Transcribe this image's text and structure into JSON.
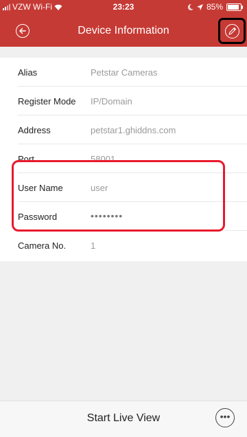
{
  "status_bar": {
    "carrier": "VZW Wi-Fi",
    "time": "23:23",
    "battery": "85%"
  },
  "header": {
    "title": "Device Information",
    "back_icon": "back-arrow-circle-icon",
    "edit_icon": "pencil-icon"
  },
  "fields": {
    "alias": {
      "label": "Alias",
      "value": "Petstar Cameras"
    },
    "register_mode": {
      "label": "Register Mode",
      "value": "IP/Domain"
    },
    "address": {
      "label": "Address",
      "value": "petstar1.ghiddns.com"
    },
    "port": {
      "label": "Port",
      "value": "58001"
    },
    "user_name": {
      "label": "User Name",
      "value": "user"
    },
    "password": {
      "label": "Password",
      "value": "••••••••"
    },
    "camera_no": {
      "label": "Camera No.",
      "value": "1"
    }
  },
  "footer": {
    "start_live_view": "Start Live View",
    "more_icon": "more-ellipsis-icon"
  },
  "colors": {
    "header": "#c63a35",
    "highlight": "#e8192c",
    "edit_highlight": "#000000"
  }
}
